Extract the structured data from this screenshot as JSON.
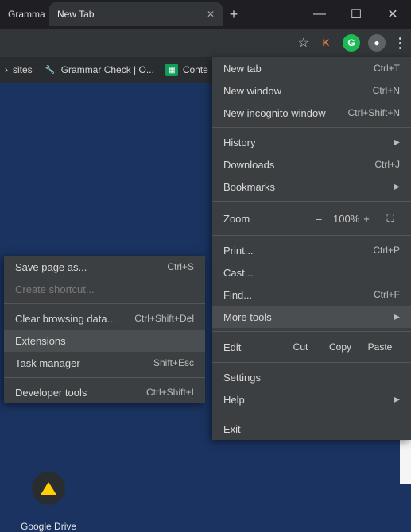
{
  "tabs": {
    "left": "Gramma",
    "active": "New Tab"
  },
  "bookmarks": {
    "sites": "sites",
    "grammar": "Grammar Check | O...",
    "conte": "Conte"
  },
  "menu": {
    "new_tab": "New tab",
    "new_tab_sc": "Ctrl+T",
    "new_window": "New window",
    "new_window_sc": "Ctrl+N",
    "incognito": "New incognito window",
    "incognito_sc": "Ctrl+Shift+N",
    "history": "History",
    "downloads": "Downloads",
    "downloads_sc": "Ctrl+J",
    "bookmarks": "Bookmarks",
    "zoom": "Zoom",
    "zoom_val": "100%",
    "print": "Print...",
    "print_sc": "Ctrl+P",
    "cast": "Cast...",
    "find": "Find...",
    "find_sc": "Ctrl+F",
    "more_tools": "More tools",
    "edit": "Edit",
    "cut": "Cut",
    "copy": "Copy",
    "paste": "Paste",
    "settings": "Settings",
    "help": "Help",
    "exit": "Exit"
  },
  "submenu": {
    "save_as": "Save page as...",
    "save_as_sc": "Ctrl+S",
    "create_shortcut": "Create shortcut...",
    "clear": "Clear browsing data...",
    "clear_sc": "Ctrl+Shift+Del",
    "extensions": "Extensions",
    "task": "Task manager",
    "task_sc": "Shift+Esc",
    "dev": "Developer tools",
    "dev_sc": "Ctrl+Shift+I"
  },
  "drive": {
    "label": "Google Drive"
  }
}
